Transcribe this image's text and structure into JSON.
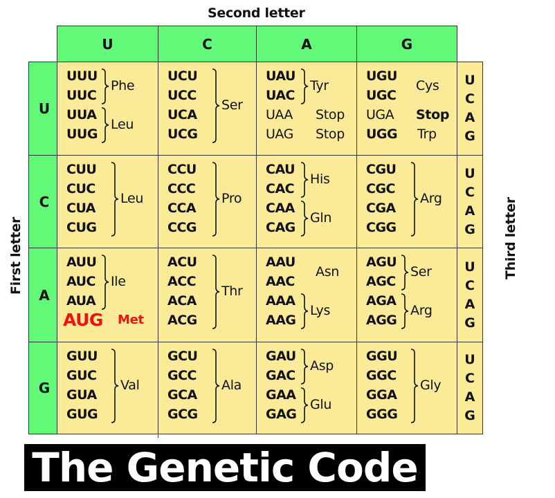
{
  "labels": {
    "second_letter": "Second letter",
    "first_letter": "First letter",
    "third_letter": "Third letter"
  },
  "bases": [
    "U",
    "C",
    "A",
    "G"
  ],
  "third_bases": [
    "U",
    "C",
    "A",
    "G"
  ],
  "colors": {
    "header_green": "#62f978",
    "cell_yellow": "#fbea98",
    "start_red": "#ee1111"
  },
  "title": "The Genetic Code",
  "table": {
    "U": {
      "U": {
        "codons": [
          "UUU",
          "UUC",
          "UUA",
          "UUG"
        ],
        "groups": [
          {
            "aa": "Phe",
            "rows": [
              0,
              1
            ]
          },
          {
            "aa": "Leu",
            "rows": [
              2,
              3
            ]
          }
        ]
      },
      "C": {
        "codons": [
          "UCU",
          "UCC",
          "UCA",
          "UCG"
        ],
        "groups": [
          {
            "aa": "Ser",
            "rows": [
              0,
              3
            ]
          }
        ]
      },
      "A": {
        "codons": [
          "UAU",
          "UAC",
          "UAA",
          "UAG"
        ],
        "groups": [
          {
            "aa": "Tyr",
            "rows": [
              0,
              1
            ]
          },
          {
            "aa": "Stop",
            "rows": [
              2,
              2
            ]
          },
          {
            "aa": "Stop",
            "rows": [
              3,
              3
            ]
          }
        ]
      },
      "G": {
        "codons": [
          "UGU",
          "UGC",
          "UGA",
          "UGG"
        ],
        "groups": [
          {
            "aa": "Cys",
            "rows": [
              0,
              1
            ]
          },
          {
            "aa": "Stop",
            "rows": [
              2,
              2
            ]
          },
          {
            "aa": "Trp",
            "rows": [
              3,
              3
            ]
          }
        ]
      }
    },
    "C": {
      "U": {
        "codons": [
          "CUU",
          "CUC",
          "CUA",
          "CUG"
        ],
        "groups": [
          {
            "aa": "Leu",
            "rows": [
              0,
              3
            ]
          }
        ]
      },
      "C": {
        "codons": [
          "CCU",
          "CCC",
          "CCA",
          "CCG"
        ],
        "groups": [
          {
            "aa": "Pro",
            "rows": [
              0,
              3
            ]
          }
        ]
      },
      "A": {
        "codons": [
          "CAU",
          "CAC",
          "CAA",
          "CAG"
        ],
        "groups": [
          {
            "aa": "His",
            "rows": [
              0,
              1
            ]
          },
          {
            "aa": "Gln",
            "rows": [
              2,
              3
            ]
          }
        ]
      },
      "G": {
        "codons": [
          "CGU",
          "CGC",
          "CGA",
          "CGG"
        ],
        "groups": [
          {
            "aa": "Arg",
            "rows": [
              0,
              3
            ]
          }
        ]
      }
    },
    "A": {
      "U": {
        "codons": [
          "AUU",
          "AUC",
          "AUA",
          "AUG"
        ],
        "groups": [
          {
            "aa": "Ile",
            "rows": [
              0,
              2
            ]
          },
          {
            "aa": "Met",
            "rows": [
              3,
              3
            ]
          }
        ]
      },
      "C": {
        "codons": [
          "ACU",
          "ACC",
          "ACA",
          "ACG"
        ],
        "groups": [
          {
            "aa": "Thr",
            "rows": [
              0,
              3
            ]
          }
        ]
      },
      "A": {
        "codons": [
          "AAU",
          "AAC",
          "AAA",
          "AAG"
        ],
        "groups": [
          {
            "aa": "Asn",
            "rows": [
              0,
              1
            ]
          },
          {
            "aa": "Lys",
            "rows": [
              2,
              3
            ]
          }
        ]
      },
      "G": {
        "codons": [
          "AGU",
          "AGC",
          "AGA",
          "AGG"
        ],
        "groups": [
          {
            "aa": "Ser",
            "rows": [
              0,
              1
            ]
          },
          {
            "aa": "Arg",
            "rows": [
              2,
              3
            ]
          }
        ]
      }
    },
    "G": {
      "U": {
        "codons": [
          "GUU",
          "GUC",
          "GUA",
          "GUG"
        ],
        "groups": [
          {
            "aa": "Val",
            "rows": [
              0,
              3
            ]
          }
        ]
      },
      "C": {
        "codons": [
          "GCU",
          "GCC",
          "GCA",
          "GCG"
        ],
        "groups": [
          {
            "aa": "Ala",
            "rows": [
              0,
              3
            ]
          }
        ]
      },
      "A": {
        "codons": [
          "GAU",
          "GAC",
          "GAA",
          "GAG"
        ],
        "groups": [
          {
            "aa": "Asp",
            "rows": [
              0,
              1
            ]
          },
          {
            "aa": "Glu",
            "rows": [
              2,
              3
            ]
          }
        ]
      },
      "G": {
        "codons": [
          "GGU",
          "GGC",
          "GGA",
          "GGG"
        ],
        "groups": [
          {
            "aa": "Gly",
            "rows": [
              0,
              3
            ]
          }
        ]
      }
    }
  },
  "styling_notes": {
    "regular_weight_codons": [
      "UAA",
      "UAG",
      "UGA"
    ],
    "bold_amino_acids_codon": [
      "UGA"
    ],
    "highlighted_start_codon": "AUG",
    "unbraced_groups": [
      "Cys",
      "Asn",
      "Met",
      "Stop",
      "Trp"
    ]
  }
}
